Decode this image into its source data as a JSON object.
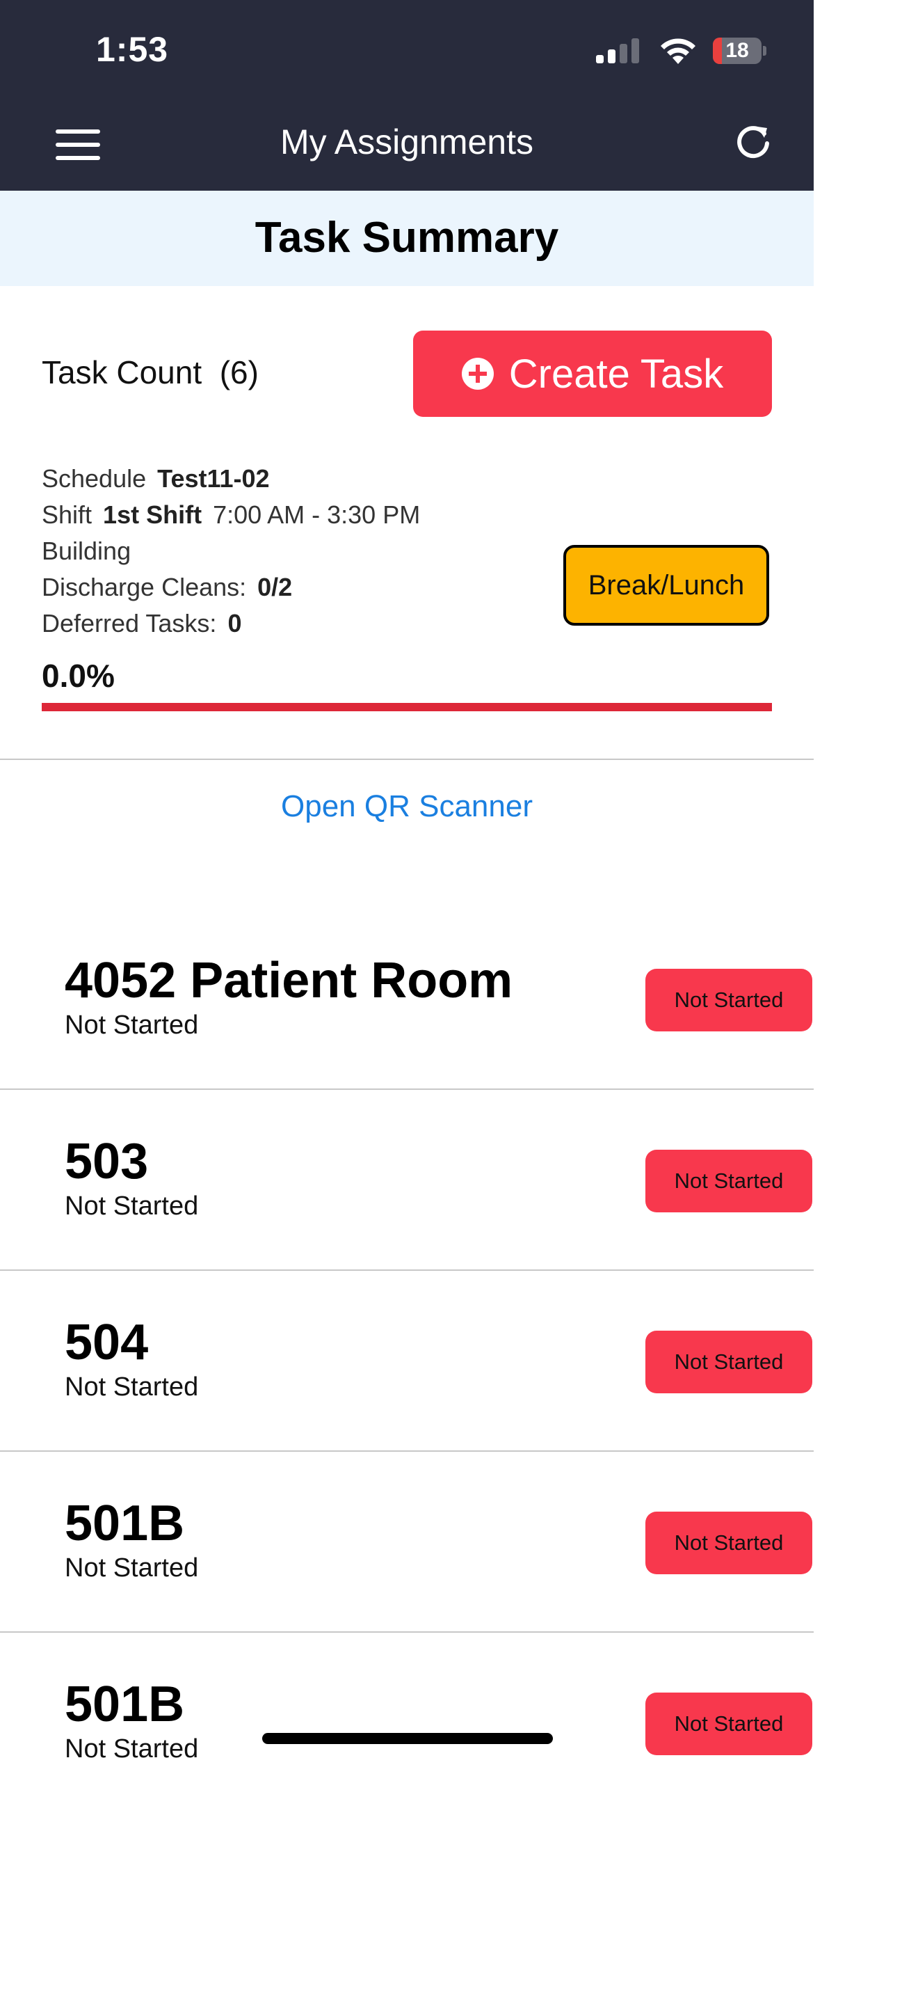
{
  "status_bar": {
    "time": "1:53",
    "battery_level": "18",
    "battery_fraction": 0.18,
    "signal_icon": "cellular-signal-icon",
    "wifi_icon": "wifi-icon",
    "battery_color": "#e9403e"
  },
  "nav": {
    "title": "My Assignments",
    "menu_icon": "hamburger-menu-icon",
    "refresh_icon": "refresh-icon",
    "background": "#282b3c"
  },
  "summary": {
    "title": "Task Summary",
    "task_count_label": "Task Count",
    "task_count_value": "(6)",
    "create_task_label": "Create Task",
    "create_task_icon": "plus-circle-icon",
    "accent": "#f8384d"
  },
  "details": {
    "schedule_label": "Schedule",
    "schedule_value": "Test11-02",
    "shift_label": "Shift",
    "shift_name": "1st Shift",
    "shift_time": "7:00 AM - 3:30 PM",
    "building_label": "Building",
    "building_value": "",
    "discharge_label": "Discharge Cleans:",
    "discharge_value": "0/2",
    "deferred_label": "Deferred Tasks:",
    "deferred_value": "0"
  },
  "break_button": {
    "label": "Break/Lunch",
    "color": "#fdb300"
  },
  "progress": {
    "label": "0.0%",
    "fraction": 0.0
  },
  "qr_link": "Open QR Scanner",
  "tasks": [
    {
      "name": "4052 Patient Room",
      "status": "Not Started",
      "badge": "Not Started"
    },
    {
      "name": "503",
      "status": "Not Started",
      "badge": "Not Started"
    },
    {
      "name": "504",
      "status": "Not Started",
      "badge": "Not Started"
    },
    {
      "name": "501B",
      "status": "Not Started",
      "badge": "Not Started"
    },
    {
      "name": "501B",
      "status": "Not Started",
      "badge": "Not Started"
    }
  ]
}
